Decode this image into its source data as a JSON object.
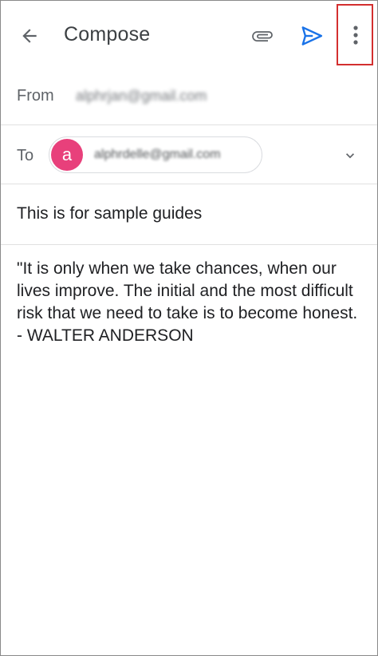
{
  "appbar": {
    "title": "Compose",
    "icons": [
      "back-arrow-icon",
      "paperclip-icon",
      "send-icon",
      "more-vertical-icon"
    ],
    "send_color": "#1a73e8",
    "highlight_color": "#d32f2f"
  },
  "from": {
    "label": "From",
    "value": "alphrjan@gmail.com"
  },
  "to": {
    "label": "To",
    "avatar_letter": "a",
    "avatar_color": "#e8407b",
    "recipient": "alphrdelle@gmail.com"
  },
  "subject": {
    "value": "This is for sample guides"
  },
  "body": {
    "text": "\"It is only when we take chances, when our lives improve. The initial and the most difficult risk that we need to take is to become honest. - WALTER ANDERSON"
  }
}
